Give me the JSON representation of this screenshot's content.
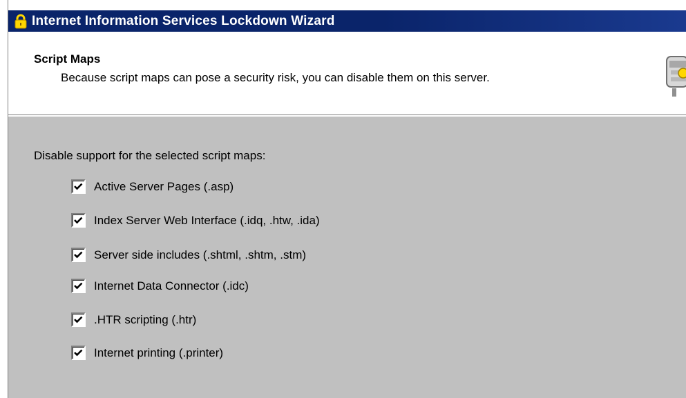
{
  "window": {
    "title": "Internet Information Services Lockdown Wizard"
  },
  "header": {
    "title": "Script Maps",
    "subtitle": "Because script maps can pose a security risk, you can disable them on this server."
  },
  "content": {
    "instruction": "Disable support for the selected script maps:",
    "options": [
      {
        "label": "Active Server Pages (.asp)",
        "checked": true
      },
      {
        "label": "Index Server Web Interface (.idq, .htw, .ida)",
        "checked": true
      },
      {
        "label": "Server side includes (.shtml, .shtm, .stm)",
        "checked": true
      },
      {
        "label": "Internet Data Connector (.idc)",
        "checked": true
      },
      {
        "label": ".HTR scripting (.htr)",
        "checked": true
      },
      {
        "label": "Internet printing (.printer)",
        "checked": true
      }
    ]
  },
  "icons": {
    "title_icon": "lock-icon",
    "wizard_icon": "keys-icon"
  },
  "colors": {
    "titlebar": "#0a246a",
    "dialog_face": "#c0c0c0",
    "header_bg": "#ffffff"
  }
}
